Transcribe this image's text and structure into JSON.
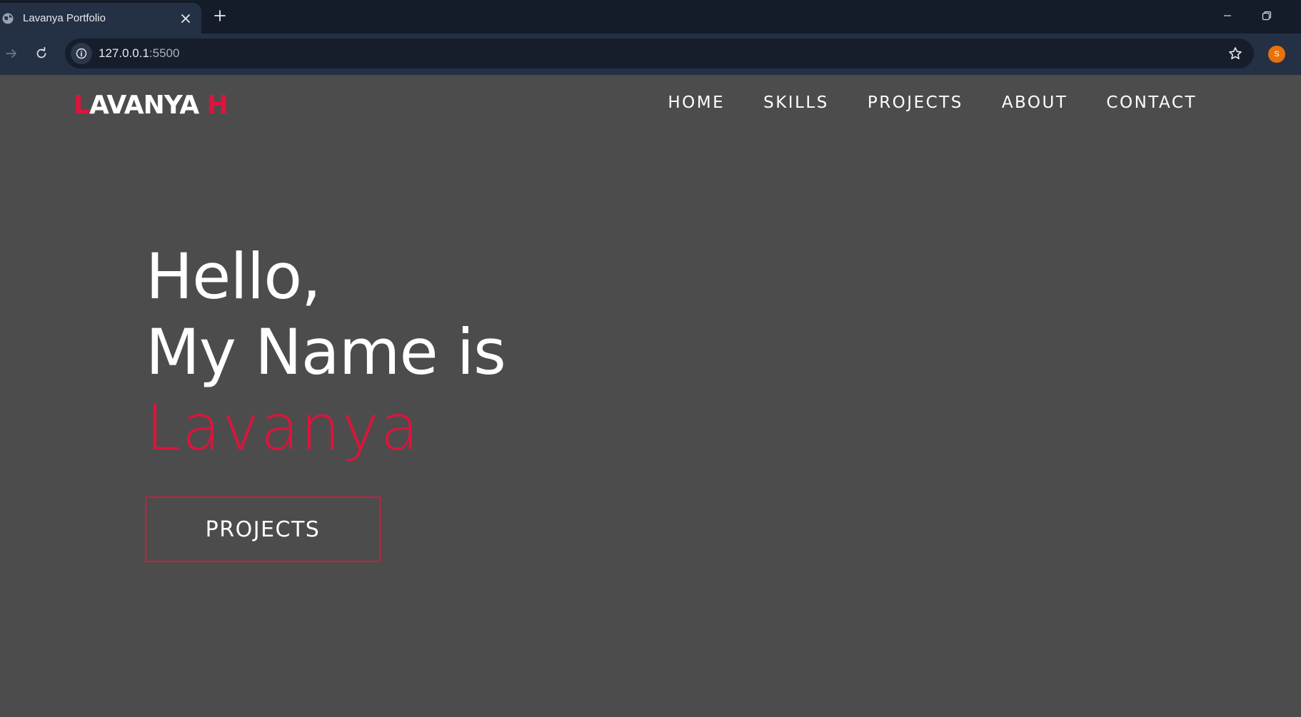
{
  "browser": {
    "tab_title": "Lavanya Portfolio",
    "url_host": "127.0.0.1",
    "url_port": ":5500",
    "profile_initial": "S",
    "icons": {
      "favicon": "globe-icon",
      "tab_close": "close-icon",
      "new_tab": "plus-icon",
      "minimize": "minimize-icon",
      "restore": "restore-icon",
      "forward": "forward-arrow-icon",
      "reload": "reload-icon",
      "site_info": "info-icon",
      "bookmark": "star-icon"
    }
  },
  "site": {
    "logo_first_letter": "L",
    "logo_rest": "AVANYA ",
    "logo_last_letter": "H",
    "nav": [
      "HOME",
      "SKILLS",
      "PROJECTS",
      "ABOUT",
      "CONTACT"
    ],
    "hero": {
      "line1": "Hello,",
      "line2": "My Name is",
      "name": "Lavanya",
      "cta_label": "PROJECTS"
    }
  },
  "colors": {
    "accent": "#dc143c",
    "page_background": "#4c4c4c",
    "text": "#ffffff",
    "browser_frame": "#141b29",
    "browser_toolbar": "#243044",
    "profile_avatar": "#e8710a"
  }
}
